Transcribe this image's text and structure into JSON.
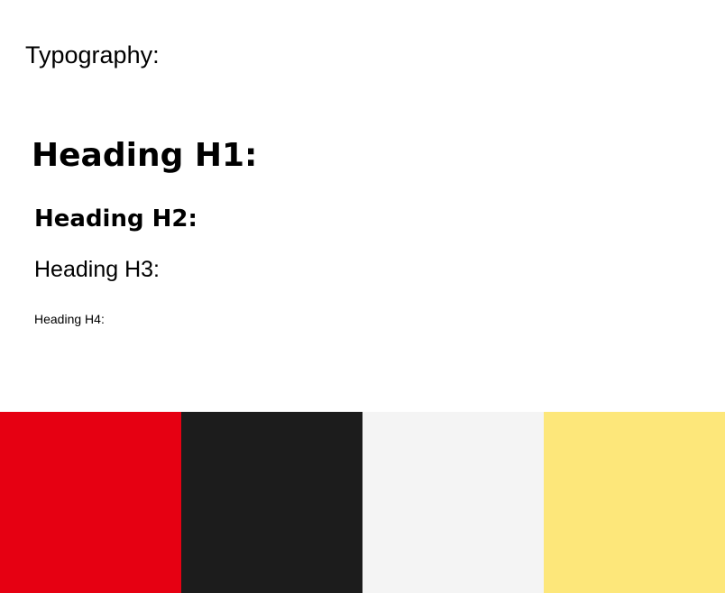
{
  "typography": {
    "title": "Typography:",
    "h1": "Heading H1:",
    "h2": "Heading H2:",
    "h3": "Heading H3:",
    "h4": "Heading H4:"
  },
  "palette": {
    "colors": [
      "#e60012",
      "#1c1c1c",
      "#f4f4f4",
      "#fde77a"
    ]
  }
}
